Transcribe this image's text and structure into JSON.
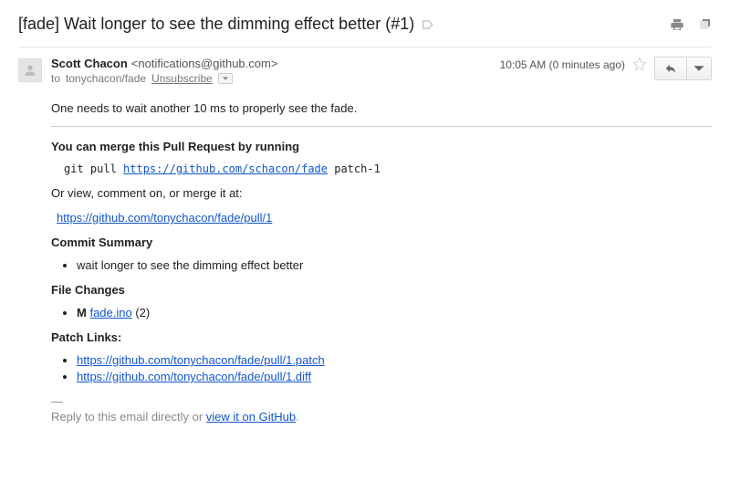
{
  "subject": "[fade] Wait longer to see the dimming effect better (#1)",
  "actions": {
    "print": "Print",
    "newwin": "Open in new window"
  },
  "meta": {
    "from_name": "Scott Chacon",
    "from_email": "<notifications@github.com>",
    "to_prefix": "to",
    "to_target": "tonychacon/fade",
    "unsubscribe": "Unsubscribe",
    "time": "10:05 AM (0 minutes ago)"
  },
  "body": {
    "intro": "One needs to wait another 10 ms to properly see the fade.",
    "merge_heading": "You can merge this Pull Request by running",
    "git_cmd_prefix": "git pull ",
    "git_url": "https://github.com/schacon/fade",
    "git_branch": " patch-1",
    "view_text": "Or view, comment on, or merge it at:",
    "pr_url": "https://github.com/tonychacon/fade/pull/1",
    "commit_heading": "Commit Summary",
    "commit_item": "wait longer to see the dimming effect better",
    "file_heading": "File Changes",
    "file_status": "M",
    "file_name": "fade.ino",
    "file_lines": " (2)",
    "patch_heading": "Patch Links:",
    "patch_link": "https://github.com/tonychacon/fade/pull/1.patch",
    "diff_link": "https://github.com/tonychacon/fade/pull/1.diff",
    "sig_dash": "—",
    "reply_note_prefix": "Reply to this email directly or ",
    "reply_note_link": "view it on GitHub",
    "reply_note_suffix": "."
  }
}
